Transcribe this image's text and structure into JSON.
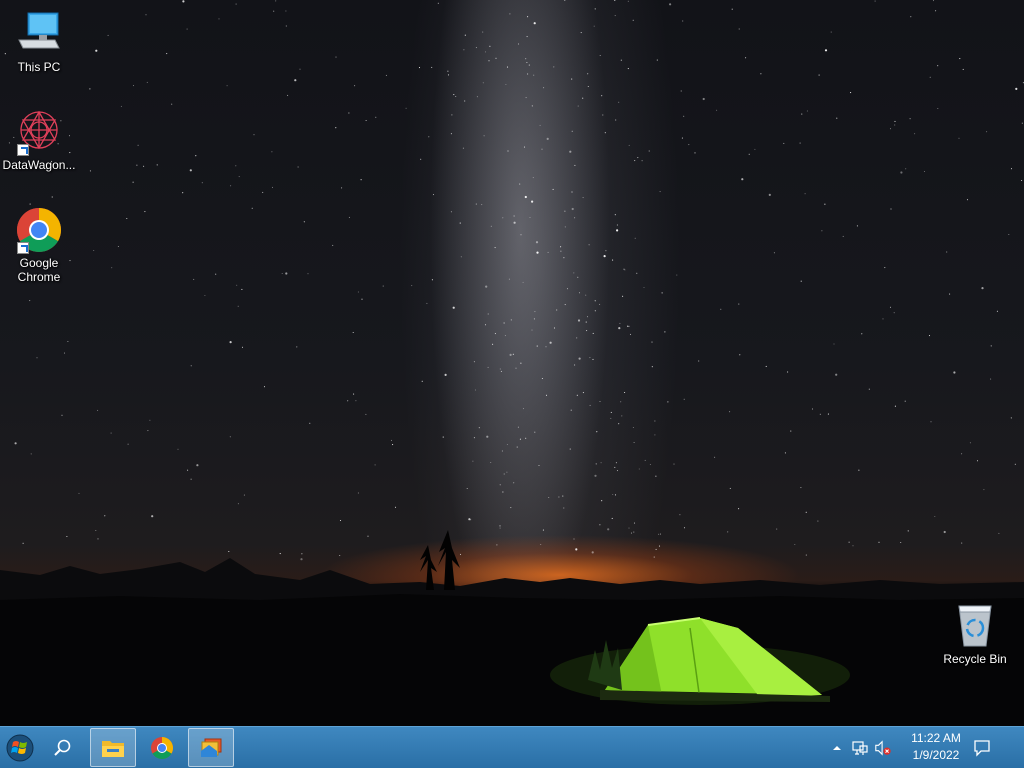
{
  "desktop": {
    "icons": [
      {
        "label": "This PC",
        "icon": "this-pc-icon"
      },
      {
        "label": "DataWagon...",
        "icon": "datawagon-icon",
        "shortcut": true
      },
      {
        "label": "Google\nChrome",
        "icon": "chrome-icon",
        "shortcut": true
      },
      {
        "label": "Recycle Bin",
        "icon": "recycle-bin-icon"
      }
    ]
  },
  "taskbar": {
    "start": {
      "icon": "windows-start-icon"
    },
    "search": {
      "icon": "search-icon"
    },
    "apps": [
      {
        "name": "File Explorer",
        "icon": "file-explorer-icon",
        "active": true
      },
      {
        "name": "Google Chrome",
        "icon": "chrome-icon",
        "active": false
      },
      {
        "name": "Remote Desktop",
        "icon": "app-window-icon",
        "active": true
      }
    ],
    "tray": {
      "chevron": "chevron-up-icon",
      "network": "network-icon",
      "volume": "volume-muted-icon"
    },
    "clock": {
      "time": "11:22 AM",
      "date": "1/9/2022"
    },
    "notifications": {
      "icon": "action-center-icon"
    }
  },
  "colors": {
    "taskbar": "#2f78b2",
    "tent": "#8fe02a",
    "horizon_glow": "#e8702a"
  }
}
